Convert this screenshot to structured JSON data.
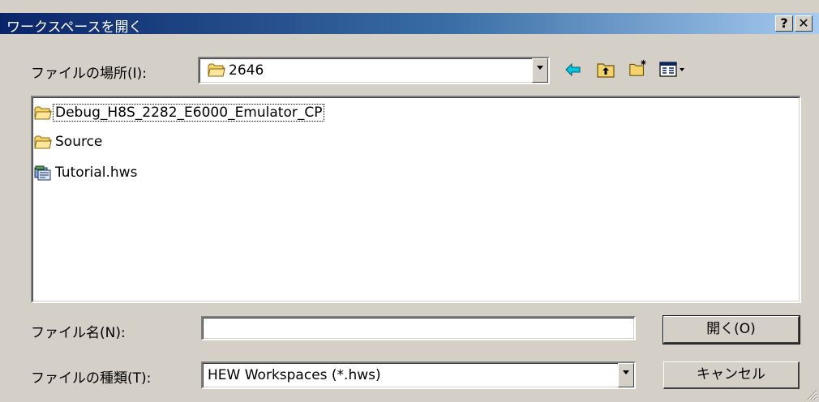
{
  "window": {
    "title": "ワークスペースを開く",
    "help_label": "?",
    "close_label": "✕"
  },
  "location": {
    "label": "ファイルの場所(I):",
    "value": "2646",
    "icon": "folder-icon"
  },
  "toolbar": {
    "back_icon": "back-arrow-icon",
    "up_icon": "up-folder-icon",
    "new_folder_icon": "new-folder-icon",
    "view_icon": "view-menu-icon"
  },
  "files": [
    {
      "name": "Debug_H8S_2282_E6000_Emulator_CP",
      "type": "folder",
      "icon": "folder-icon",
      "focused": true
    },
    {
      "name": "Source",
      "type": "folder",
      "icon": "folder-icon"
    },
    {
      "name": "Tutorial.hws",
      "type": "workspace",
      "icon": "workspace-file-icon"
    }
  ],
  "filename": {
    "label": "ファイル名(N):",
    "value": ""
  },
  "filetype": {
    "label": "ファイルの種類(T):",
    "value": "HEW Workspaces (*.hws)"
  },
  "buttons": {
    "open": "開く(O)",
    "cancel": "キャンセル"
  },
  "colors": {
    "titlebar_start": "#0a246a",
    "titlebar_end": "#a6caf0",
    "dialog_bg": "#d4d0c8"
  }
}
